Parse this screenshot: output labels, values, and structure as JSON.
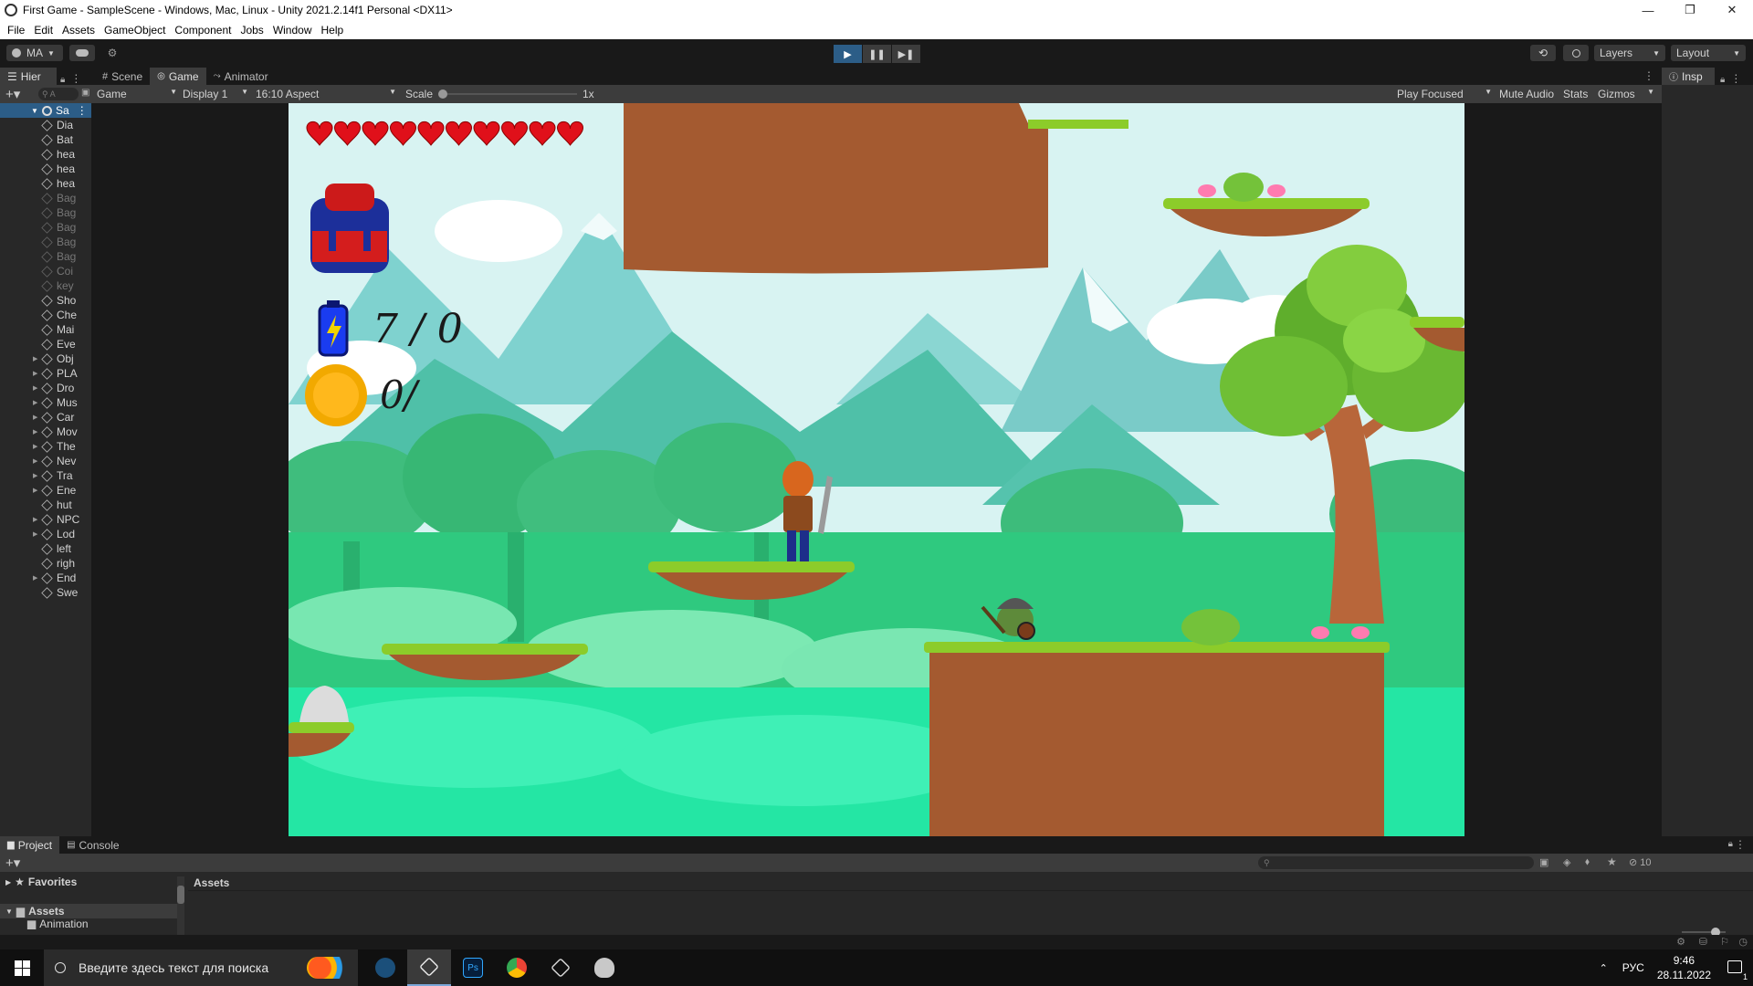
{
  "window": {
    "title": "First Game - SampleScene - Windows, Mac, Linux - Unity 2021.2.14f1 Personal <DX11>",
    "controls": {
      "minimize": "—",
      "maximize": "❐",
      "close": "✕"
    }
  },
  "menu": [
    "File",
    "Edit",
    "Assets",
    "GameObject",
    "Component",
    "Jobs",
    "Window",
    "Help"
  ],
  "toolbar": {
    "account": "MA",
    "layers": "Layers",
    "layout": "Layout",
    "play": "▶",
    "pause": "❚❚",
    "step": "▶❚"
  },
  "hierarchy": {
    "tab": "Hier",
    "search_placeholder": "A",
    "scene": "Sa",
    "items": [
      {
        "label": "Dia",
        "dim": false,
        "expand": false
      },
      {
        "label": "Bat",
        "dim": false,
        "expand": false
      },
      {
        "label": "hea",
        "dim": false,
        "expand": false
      },
      {
        "label": "hea",
        "dim": false,
        "expand": false
      },
      {
        "label": "hea",
        "dim": false,
        "expand": false
      },
      {
        "label": "Bag",
        "dim": true,
        "expand": false
      },
      {
        "label": "Bag",
        "dim": true,
        "expand": false
      },
      {
        "label": "Bag",
        "dim": true,
        "expand": false
      },
      {
        "label": "Bag",
        "dim": true,
        "expand": false
      },
      {
        "label": "Bag",
        "dim": true,
        "expand": false
      },
      {
        "label": "Coi",
        "dim": true,
        "expand": false
      },
      {
        "label": "key",
        "dim": true,
        "expand": false
      },
      {
        "label": "Sho",
        "dim": false,
        "expand": false
      },
      {
        "label": "Che",
        "dim": false,
        "expand": false
      },
      {
        "label": "Mai",
        "dim": false,
        "expand": false
      },
      {
        "label": "Eve",
        "dim": false,
        "expand": false
      },
      {
        "label": "Obj",
        "dim": false,
        "expand": true
      },
      {
        "label": "PLA",
        "dim": false,
        "expand": true
      },
      {
        "label": "Dro",
        "dim": false,
        "expand": true
      },
      {
        "label": "Mus",
        "dim": false,
        "expand": true
      },
      {
        "label": "Car",
        "dim": false,
        "expand": true
      },
      {
        "label": "Mov",
        "dim": false,
        "expand": true
      },
      {
        "label": "The",
        "dim": false,
        "expand": true
      },
      {
        "label": "Nev",
        "dim": false,
        "expand": true
      },
      {
        "label": "Tra",
        "dim": false,
        "expand": true
      },
      {
        "label": "Ene",
        "dim": false,
        "expand": true
      },
      {
        "label": "hut",
        "dim": false,
        "expand": false
      },
      {
        "label": "NPC",
        "dim": false,
        "expand": true
      },
      {
        "label": "Lod",
        "dim": false,
        "expand": true
      },
      {
        "label": "left",
        "dim": false,
        "expand": false
      },
      {
        "label": "righ",
        "dim": false,
        "expand": false
      },
      {
        "label": "End",
        "dim": false,
        "expand": true
      },
      {
        "label": "Swe",
        "dim": false,
        "expand": false
      }
    ]
  },
  "game_view": {
    "tabs": [
      "Scene",
      "Game",
      "Animator"
    ],
    "active_tab": "Game",
    "game_dropdown": "Game",
    "display": "Display 1",
    "aspect": "16:10 Aspect",
    "scale_label": "Scale",
    "scale_value": "1x",
    "play_focused": "Play Focused",
    "mute_audio": "Mute Audio",
    "stats": "Stats",
    "gizmos": "Gizmos"
  },
  "hud": {
    "hearts": 10,
    "ammo": "7 / 0",
    "coins": "0/"
  },
  "inspector": {
    "tab": "Insp"
  },
  "project": {
    "tabs": [
      "Project",
      "Console"
    ],
    "favorites": "Favorites",
    "assets": "Assets",
    "assets_breadcrumb": "Assets",
    "animation": "Animation",
    "hidden_count": "10"
  },
  "taskbar": {
    "search_placeholder": "Введите здесь текст для поиска",
    "lang": "РУС",
    "time": "9:46",
    "date": "28.11.2022",
    "notifications": "1"
  },
  "colors": {
    "sky": "#d8f4f4",
    "grass": "#8ccc2a",
    "dirt": "#a45a30",
    "heart": "#e0101a",
    "play_active": "#2c5d87"
  }
}
